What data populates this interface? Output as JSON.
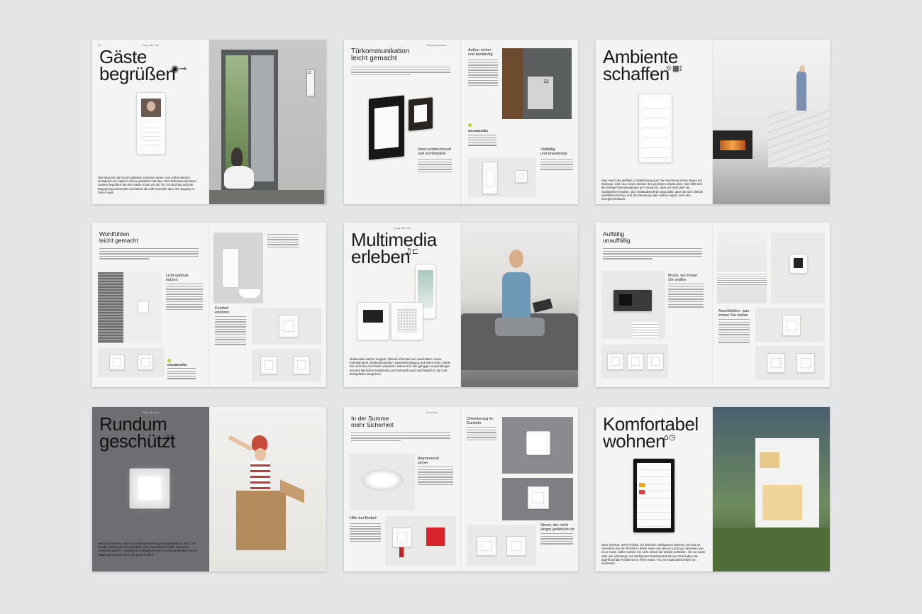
{
  "spreads": [
    {
      "id": "gaeste",
      "folio_left": "10",
      "folio_mid": "Living with Gira",
      "headline": "Gäste\nbegrüßen",
      "body": "Wie lässt sich die Kommunikation zwischen Innen- und Außen-bereich einladend und zugleich sicher gestalten? Mit dem Gira Türkommunikations-System begrüßen Sie Ihre Gäste schon vor der Tür. So sind Sie auf jede Begegnung vorbereitet und haben die volle Kontrolle über den Zugang zu Ihrem Haus.",
      "door_number": "13"
    },
    {
      "id": "tuerkommunikation",
      "headline": "Türkommunikation\nleicht gemacht",
      "section": "Türkommunikation",
      "right_heading": "Außen sicher\nund beständig",
      "door_number": "12",
      "label_1": "Innen eindrucksvoll\nund komfortabel",
      "label_2": "Vielfältig\nund erweiterbar",
      "benefits": "Gira Benefits"
    },
    {
      "id": "ambiente",
      "headline": "Ambiente\nschaffen",
      "body": "Was macht die perfekte Lichtstimmung aus? Sie macht aus einem Raum ein Zuhause. Oder aus einem Zimmer den perfekten Arbeits-platz. Wie fühlt sich die richtige Raumtemperatur an? Genau so, dass wir nicht über sie nachdenken müssen. Gira Gebäudetechnik sorgt dafür, dass Sie sich einfach wohlfühlen können und die Steuerung alles andere regelt. Auch den Energieverbrauch."
    },
    {
      "id": "wohlfuehlen",
      "headline": "Wohlfühlen\nleicht gemacht",
      "label_1": "Licht optimal\nnutzen",
      "label_2": "Komfort\nerfahren",
      "benefits": "Gira Benefits"
    },
    {
      "id": "multimedia",
      "folio_mid": "Living with Gira",
      "headline": "Multimedia\nerleben",
      "body": "Multimedia macht's möglich: Überall informiert und unterhalten. Home Entertainment, Medienplaumaton, Datenübertragung und vieles mehr. Damit Sie nicht den Anschluss verpassen, lassen sich alle gängigen Anwendungen aus den Bereichen Multimedia und Netzwerk auch nachträglich in die Gira Designlinien integrieren."
    },
    {
      "id": "auffaellig",
      "headline": "Auffällig\nunauffällig",
      "label_1": "Musik, wo immer\nSie wollen",
      "label_2": "Anschließen, was\nimmer Sie wollen"
    },
    {
      "id": "rundum",
      "folio_mid": "Living with Gira",
      "headline": "Rundum\ngeschützt",
      "body": "Was ist Sicherheit, wenn nicht die Gewissheit gut aufgehoben zu sein? Die Zweifel schnell aus dem Dunkeln holen: Rauchwarnmelder oder LED-Orientierungslicht – intelligente Gebäudetechnik von Gira unterstützt Sie im Alltag und schenkt Ihnen ein gutes Gefühl."
    },
    {
      "id": "summe",
      "headline": "In der Summe\nmehr Sicherheit",
      "section": "Sicherheit",
      "label_1": "Alarmierend\nsicher",
      "label_2": "Hilfe bei Bedarf",
      "label_3": "Orientierung im\nDunkeln",
      "label_4": "Strom, der nicht\nlänger gefährlich ist"
    },
    {
      "id": "komfortabel",
      "headline": "Komfortabel\nwohnen",
      "body": "Mehr Komfort, mehr Freiheit. So fühlt sich intelligentes Wohnen mit Gira an. Vernetzen Sie die Technik in Ihrem Haus und steuern Licht und Jalousien aus einer Hand. Dafür müssen Sie nicht einmal die Wände aufreißen. Ob zu Hause oder von unterwegs: mit intelligenter Gebäudetechnik von Gira haben Sie Zugriff auf alle Funktionen in Ihrem Haus. Für ein maximales Gefühl von Sicherheit."
    }
  ],
  "icons": {
    "gaeste": "eye-key-icon",
    "ambiente": "light-thermostat-icon",
    "multimedia": "music-note-icon",
    "rundum": "alarm-icon",
    "komfortabel": "home-clock-icon"
  },
  "colors": {
    "background": "#e4e5e6",
    "paper": "#f4f4f2",
    "accent_green": "#b6d33a",
    "alarm_red": "#d8232a",
    "grey_page": "#6d6e72"
  }
}
